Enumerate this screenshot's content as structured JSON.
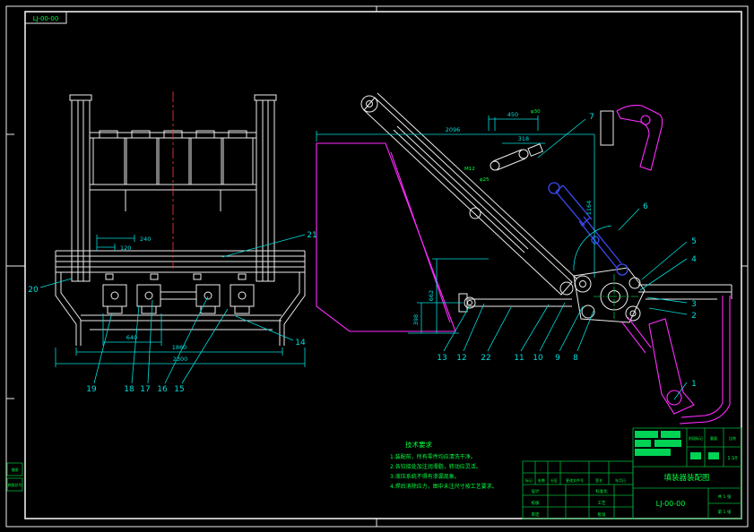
{
  "colors": {
    "background": "#000000",
    "outline": "#ececec",
    "dimension": "#00dede",
    "centerline": "#ff3b30",
    "highlight": "#ff2bff",
    "hydraulic": "#3b49f0",
    "annotation": "#00ff41"
  },
  "corner_label": "LJ-00-00",
  "margin_boxes": [
    "描图",
    "底图总号"
  ],
  "balloons": [
    {
      "label": "21"
    },
    {
      "label": "20"
    },
    {
      "label": "19"
    },
    {
      "label": "18"
    },
    {
      "label": "17"
    },
    {
      "label": "16"
    },
    {
      "label": "15"
    },
    {
      "label": "14"
    },
    {
      "label": "13"
    },
    {
      "label": "12"
    },
    {
      "label": "22"
    },
    {
      "label": "11"
    },
    {
      "label": "10"
    },
    {
      "label": "9"
    },
    {
      "label": "8"
    },
    {
      "label": "7"
    },
    {
      "label": "6"
    },
    {
      "label": "5"
    },
    {
      "label": "4"
    },
    {
      "label": "3"
    },
    {
      "label": "2"
    },
    {
      "label": "1"
    }
  ],
  "dimensions": {
    "lv_detail_a": "240",
    "lv_detail_b": "120",
    "lv_roller_span": "640",
    "lv_inner_width": "1860",
    "lv_outer_width": "2300",
    "rv_top_span": "2096",
    "rv_height": "1164",
    "rv_link_a": "450",
    "rv_link_b": "318",
    "rv_vert_a": "662",
    "rv_vert_b": "398"
  },
  "annotations": {
    "a": "M12",
    "b": "φ25",
    "c": "φ30"
  },
  "notes": {
    "title": "技术要求",
    "items": [
      "1.装配前，所有零件均应清洗干净。",
      "2.各铰接处加注润滑脂，转动应灵活。",
      "3.液压系统不得有渗漏现象。",
      "4.焊后消除应力，图中未注尺寸按工艺要求。"
    ]
  },
  "title_block": {
    "part_name": "填装器装配图",
    "drawing_no": "LJ-00-00",
    "stage_label": "阶段标记",
    "weight_label": "重量",
    "scale_label": "比例",
    "scale_value": "1:10",
    "sheet_total": "共 1 张",
    "sheet_no": "第 1 张",
    "rev_headers": [
      "标记",
      "处数",
      "分区",
      "更改文件号",
      "签名",
      "年月日"
    ],
    "sign_labels_left": [
      "设计",
      "校核",
      "审定"
    ],
    "sign_labels_right": [
      "标准化",
      "工艺",
      "批准"
    ]
  }
}
